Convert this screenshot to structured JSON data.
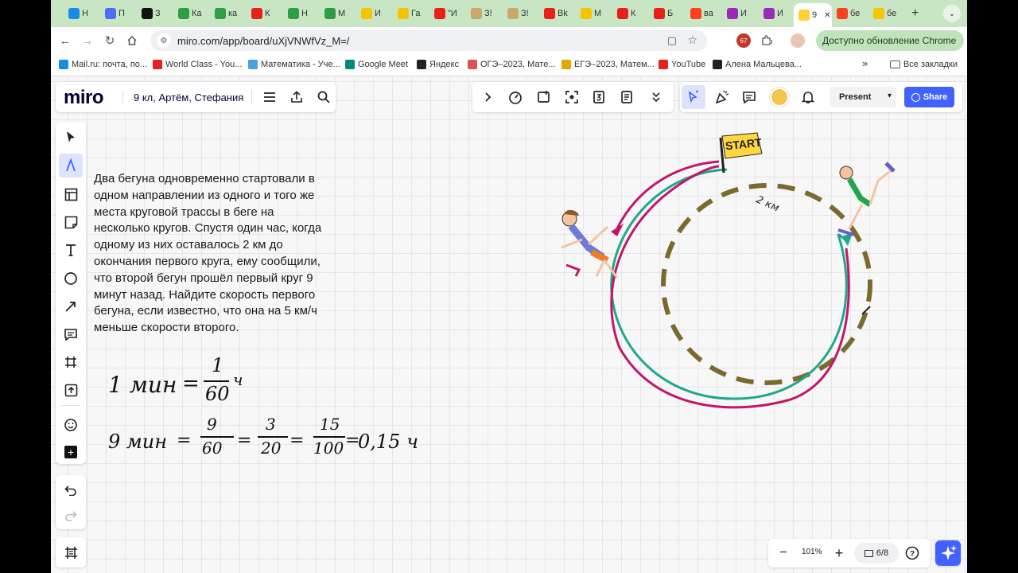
{
  "browser": {
    "tabs": [
      {
        "icon": "mailru-icon",
        "label": "Н",
        "color": "#168de2"
      },
      {
        "icon": "mail-icon",
        "label": "П",
        "color": "#4c6ef5"
      },
      {
        "icon": "uchi-icon",
        "label": "З",
        "color": "#111111"
      },
      {
        "icon": "plus-icon",
        "label": "Ка",
        "color": "#2e9e44"
      },
      {
        "icon": "plus-icon",
        "label": "ка",
        "color": "#2e9e44"
      },
      {
        "icon": "youtube-icon",
        "label": "К",
        "color": "#e62117"
      },
      {
        "icon": "plus-icon",
        "label": "Н",
        "color": "#2e9e44"
      },
      {
        "icon": "plus-icon",
        "label": "М",
        "color": "#2e9e44"
      },
      {
        "icon": "yaklass-icon",
        "label": "И",
        "color": "#f5c400"
      },
      {
        "icon": "yaklass-icon",
        "label": "Га",
        "color": "#f5c400"
      },
      {
        "icon": "youtube-icon",
        "label": "\"И",
        "color": "#e62117"
      },
      {
        "icon": "clock-icon",
        "label": "З!",
        "color": "#c9a86a"
      },
      {
        "icon": "clock-icon",
        "label": "З!",
        "color": "#c9a86a"
      },
      {
        "icon": "youtube-icon",
        "label": "Вk",
        "color": "#e62117"
      },
      {
        "icon": "play-icon",
        "label": "М",
        "color": "#f5c400"
      },
      {
        "icon": "youtube-icon",
        "label": "К",
        "color": "#e62117"
      },
      {
        "icon": "youtube-icon",
        "label": "Б",
        "color": "#e62117"
      },
      {
        "icon": "yandex-icon",
        "label": "ва",
        "color": "#fc3f1d"
      },
      {
        "icon": "wb-icon",
        "label": "И",
        "color": "#9b2bb5"
      },
      {
        "icon": "wb-icon",
        "label": "И",
        "color": "#9b2bb5"
      },
      {
        "icon": "miro-icon",
        "label": "9",
        "color": "#ffd02f",
        "active": true
      },
      {
        "icon": "yandex-icon",
        "label": "бе",
        "color": "#fc3f1d"
      },
      {
        "icon": "image-icon",
        "label": "бе",
        "color": "#f7c600"
      }
    ],
    "url": "miro.com/app/board/uXjVNWfVz_M=/",
    "extension_badge": "67",
    "update_label": "Доступно обновление Chrome",
    "bookmarks": [
      {
        "label": "Mail.ru: почта, по...",
        "color": "#168de2"
      },
      {
        "label": "World Class - You...",
        "color": "#e62117"
      },
      {
        "label": "Математика - Уче...",
        "color": "#4aa3df"
      },
      {
        "label": "Google Meet",
        "color": "#00897b"
      },
      {
        "label": "Яндекс",
        "color": "#222222"
      },
      {
        "label": "ОГЭ–2023, Мате...",
        "color": "#d9534f"
      },
      {
        "label": "ЕГЭ–2023, Матем...",
        "color": "#e0a800"
      },
      {
        "label": "YouTube",
        "color": "#e62117"
      },
      {
        "label": "Алена Мальцева...",
        "color": "#222222"
      }
    ],
    "all_bookmarks": "Все закладки"
  },
  "miro": {
    "logo": "miro",
    "board_name": "9 кл, Артём, Стефания",
    "present_label": "Present",
    "share_label": "Share",
    "zoom": "101%",
    "pages": "6/8"
  },
  "problem_text": "Два бегуна одновременно стартовали в одном направлении из одного и того же места круговой трассы в беге на несколько кругов. Спустя один час, когда одному из них оставалось 2 км до окончания первого круга, ему сообщили, что второй бегун прошёл первый круг 9 минут назад. Найдите скорость первого бегуна, если известно, что она на 5 км/ч меньше скорости второго.",
  "handwriting": {
    "line1": [
      "1 мин",
      "=",
      "1",
      "60",
      "ч"
    ],
    "line2": [
      "9 мин",
      "=",
      "9",
      "60",
      "=",
      "3",
      "20",
      "=",
      "15",
      "100",
      "=",
      "0,15 ч"
    ]
  },
  "illustration": {
    "start_sign": "START",
    "distance_label": "2 км"
  }
}
